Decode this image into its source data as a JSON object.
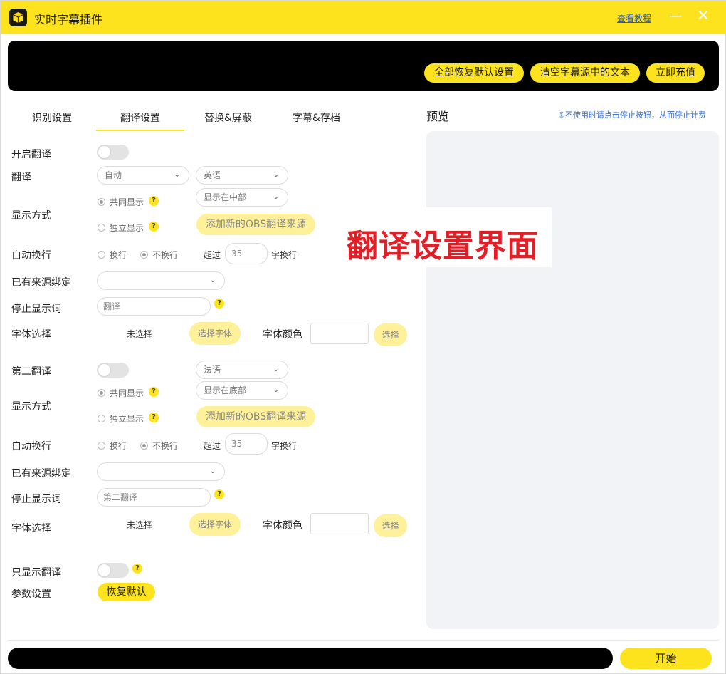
{
  "app": {
    "title": "实时字幕插件",
    "tutorial": "查看教程",
    "minimize": "—",
    "close": "✕"
  },
  "banner": {
    "reset_all": "全部恢复默认设置",
    "clear_text": "清空字幕源中的文本",
    "recharge": "立即充值"
  },
  "tabs": [
    {
      "label": "识别设置"
    },
    {
      "label": "翻译设置"
    },
    {
      "label": "替换&屏蔽"
    },
    {
      "label": "字幕&存档"
    }
  ],
  "preview": {
    "title": "预览",
    "note": "①不使用时请点击停止按钮，从而停止计费"
  },
  "overlay": {
    "text": "翻译设置界面"
  },
  "translation": {
    "enable_label": "开启翻译",
    "translate_label": "翻译",
    "source_lang": "自动",
    "target_lang": "英语",
    "display_mode_label": "显示方式",
    "joint_display": "共同显示",
    "separate_display": "独立显示",
    "position": "显示在中部",
    "add_obs_source": "添加新的OBS翻译来源",
    "auto_wrap_label": "自动换行",
    "wrap": "换行",
    "no_wrap": "不换行",
    "exceed": "超过",
    "wrap_count": "35",
    "chars_wrap": "字换行",
    "bound_source_label": "已有来源绑定",
    "stop_words_label": "停止显示词",
    "stop_words_placeholder": "翻译",
    "font_label": "字体选择",
    "font_value": "未选择",
    "select_font": "选择字体",
    "font_color_label": "字体颜色",
    "select_color": "选择"
  },
  "second": {
    "enable_label": "第二翻译",
    "target_lang": "法语",
    "display_mode_label": "显示方式",
    "joint_display": "共同显示",
    "separate_display": "独立显示",
    "position": "显示在底部",
    "add_obs_source": "添加新的OBS翻译来源",
    "auto_wrap_label": "自动换行",
    "wrap": "换行",
    "no_wrap": "不换行",
    "exceed": "超过",
    "wrap_count": "35",
    "chars_wrap": "字换行",
    "bound_source_label": "已有来源绑定",
    "stop_words_label": "停止显示词",
    "stop_words_placeholder": "第二翻译",
    "font_label": "字体选择",
    "font_value": "未选择",
    "select_font": "选择字体",
    "font_color_label": "字体颜色",
    "select_color": "选择"
  },
  "misc": {
    "only_translation_label": "只显示翻译",
    "params_label": "参数设置",
    "restore_default": "恢复默认"
  },
  "footer": {
    "start": "开始"
  },
  "icons": {
    "help": "?",
    "chevron": "⌄"
  }
}
